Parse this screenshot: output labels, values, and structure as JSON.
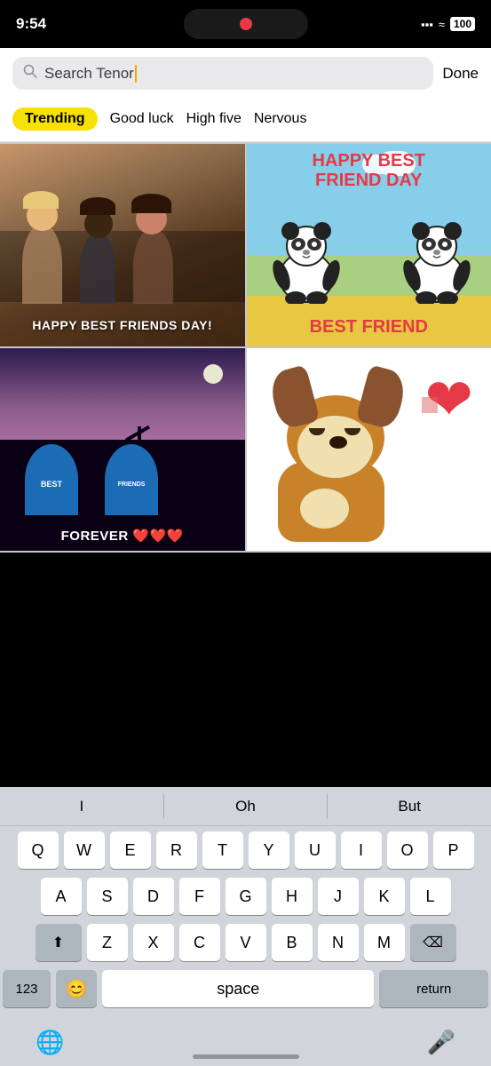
{
  "statusBar": {
    "time": "9:54",
    "batteryLevel": "100"
  },
  "searchBar": {
    "placeholder": "Search Tenor",
    "doneLabel": "Done"
  },
  "tabs": [
    {
      "id": "trending",
      "label": "Trending",
      "active": true
    },
    {
      "id": "goodluck",
      "label": "Good luck",
      "active": false
    },
    {
      "id": "highfive",
      "label": "High five",
      "active": false
    },
    {
      "id": "nervous",
      "label": "Nervous",
      "active": false
    }
  ],
  "gifs": {
    "topLeft": {
      "text": "HAPPY BEST FRIENDS DAY!",
      "type": "friends-photo"
    },
    "bottomLeft": {
      "text1": "BEST",
      "text2": "FRIENDS",
      "forever": "FOREVER ❤️❤️❤️",
      "type": "graveyard"
    },
    "topRight": {
      "title": "HAPPY BEST\nFRIEND DAY",
      "subtitle": "BEST FRIEND",
      "type": "panda"
    },
    "bottomRight": {
      "type": "puppy-heart"
    }
  },
  "predictive": {
    "words": [
      "I",
      "Oh",
      "But"
    ]
  },
  "keyboard": {
    "rows": [
      [
        "Q",
        "W",
        "E",
        "R",
        "T",
        "Y",
        "U",
        "I",
        "O",
        "P"
      ],
      [
        "A",
        "S",
        "D",
        "F",
        "G",
        "H",
        "J",
        "K",
        "L"
      ],
      [
        "⬆",
        "Z",
        "X",
        "C",
        "V",
        "B",
        "N",
        "M",
        "⌫"
      ],
      [
        "123",
        "😊",
        "space",
        "return"
      ]
    ]
  }
}
